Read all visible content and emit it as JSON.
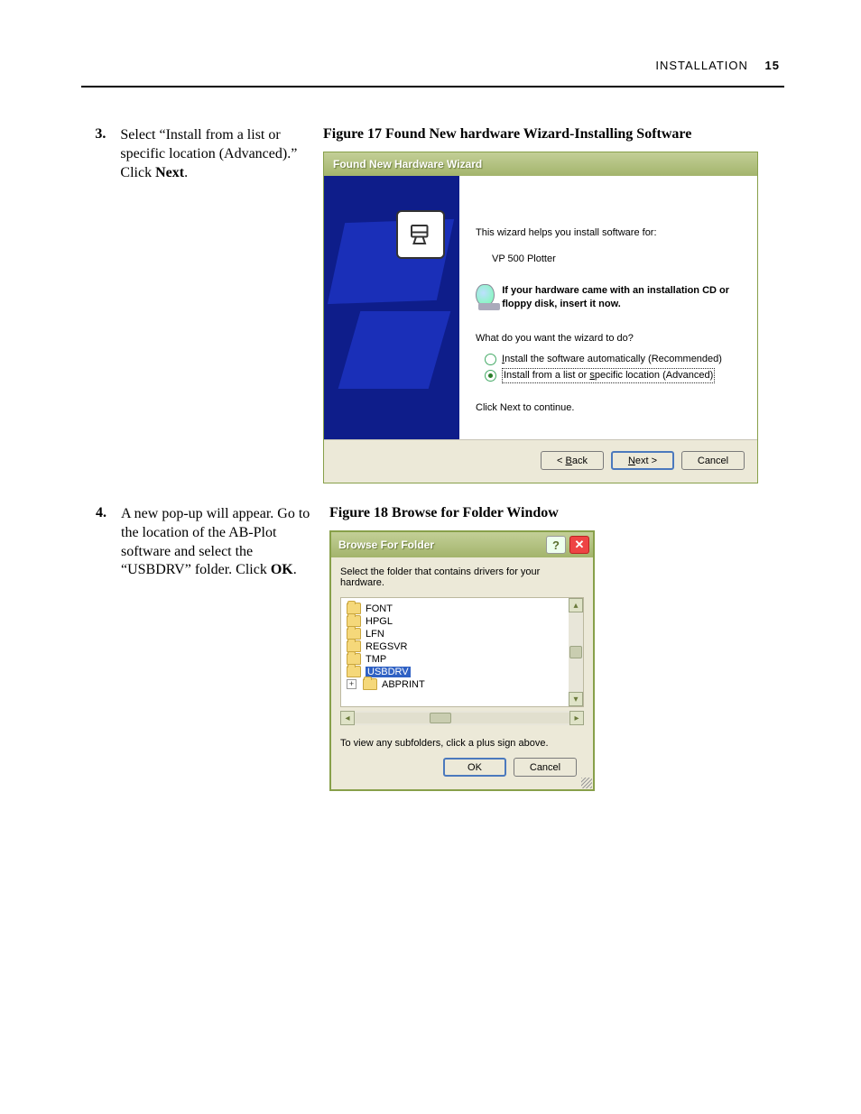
{
  "header": {
    "section": "INSTALLATION",
    "page_no": "15"
  },
  "step3": {
    "num": "3.",
    "text_a": "Select “Install from a list or specific location (Advanced).” Click ",
    "text_bold": "Next",
    "text_c": "."
  },
  "fig17": {
    "caption": "Figure 17 Found New hardware Wizard-Installing Software",
    "title": "Found New Hardware Wizard",
    "intro": "This wizard helps you install software for:",
    "device": "VP 500 Plotter",
    "cd_note": "If your hardware came with an installation CD or floppy disk, insert it now.",
    "question": "What do you want the wizard to do?",
    "opt_auto": "Install the software automatically (Recommended)",
    "opt_list": "Install from a list or specific location (Advanced)",
    "continue_hint": "Click Next to continue.",
    "btn_back": "< Back",
    "btn_next": "Next >",
    "btn_cancel": "Cancel"
  },
  "step4": {
    "num": "4.",
    "text_a": "A new pop-up will appear. Go to the location of the AB-Plot software and select the “USBDRV” folder. Click ",
    "text_bold": "OK",
    "text_c": "."
  },
  "fig18": {
    "caption": "Figure 18 Browse for Folder Window",
    "title": "Browse For Folder",
    "prompt": "Select the folder that contains drivers for your hardware.",
    "folders": {
      "f0": "FONT",
      "f1": "HPGL",
      "f2": "LFN",
      "f3": "REGSVR",
      "f4": "TMP",
      "f5_sel": "USBDRV",
      "f6": "ABPRINT"
    },
    "hint": "To view any subfolders, click a plus sign above.",
    "btn_ok": "OK",
    "btn_cancel": "Cancel"
  }
}
